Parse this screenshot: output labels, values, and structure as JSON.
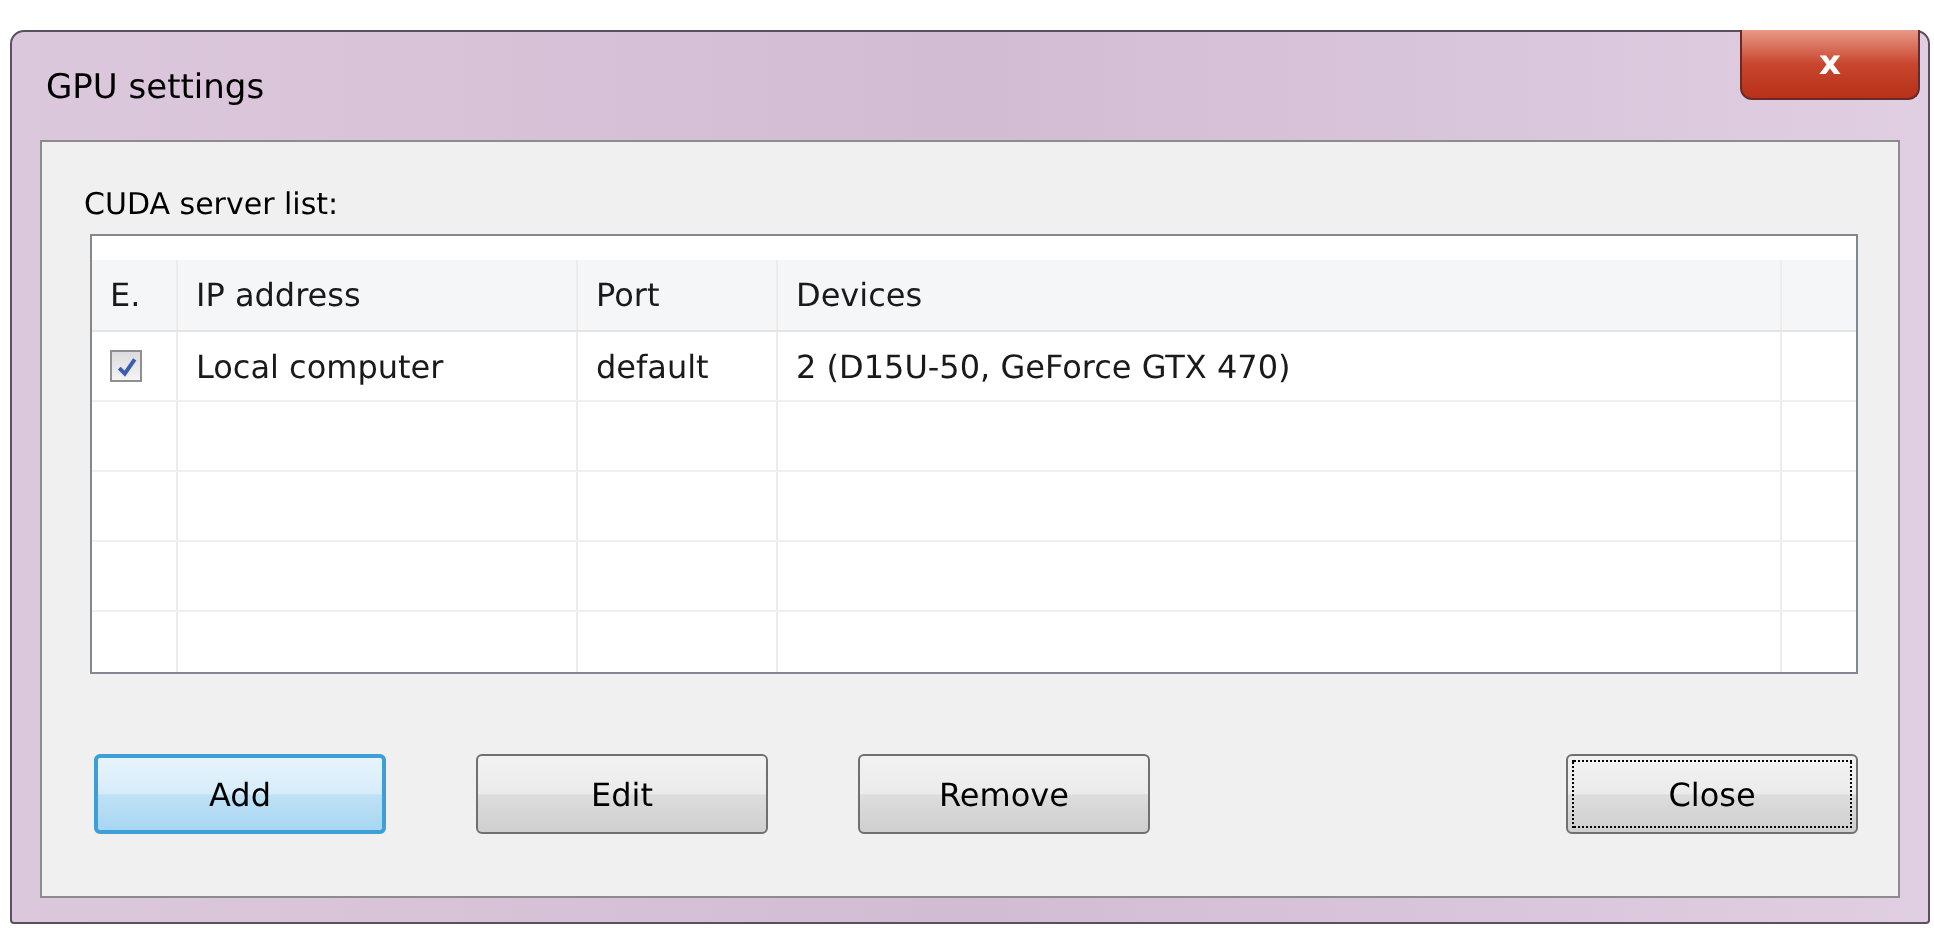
{
  "window": {
    "title": "GPU settings",
    "close_label": "x"
  },
  "server_list": {
    "label": "CUDA server list:",
    "columns": [
      "E.",
      "IP address",
      "Port",
      "Devices"
    ],
    "rows": [
      {
        "enabled": true,
        "ip_address": "Local computer",
        "port": "default",
        "devices": "2 (D15U-50, GeForce GTX 470)"
      }
    ]
  },
  "buttons": [
    {
      "label": "Add",
      "selected": true,
      "focused": false
    },
    {
      "label": "Edit",
      "selected": false,
      "focused": false
    },
    {
      "label": "Remove",
      "selected": false,
      "focused": false
    },
    {
      "label": "Close",
      "selected": false,
      "focused": true
    }
  ]
}
